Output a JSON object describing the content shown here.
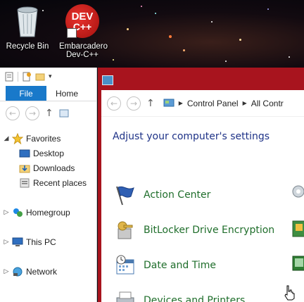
{
  "desktop": {
    "icons": [
      {
        "label": "Recycle Bin"
      },
      {
        "label": "Embarcadero Dev-C++",
        "badge_line1": "DEV",
        "badge_line2": "C++"
      }
    ]
  },
  "explorer": {
    "tabs": {
      "file": "File",
      "home": "Home"
    },
    "nav": [
      {
        "label": "Favorites",
        "icon": "star-icon"
      },
      {
        "label": "Desktop",
        "icon": "desktop-icon"
      },
      {
        "label": "Downloads",
        "icon": "downloads-icon"
      },
      {
        "label": "Recent places",
        "icon": "recent-places-icon"
      },
      {
        "label": "Homegroup",
        "icon": "homegroup-icon"
      },
      {
        "label": "This PC",
        "icon": "this-pc-icon"
      },
      {
        "label": "Network",
        "icon": "network-icon"
      }
    ]
  },
  "control_panel": {
    "breadcrumb": [
      "Control Panel",
      "All Contr"
    ],
    "heading": "Adjust your computer's settings",
    "items": [
      {
        "label": "Action Center",
        "icon": "flag-icon"
      },
      {
        "label": "BitLocker Drive Encryption",
        "icon": "bitlocker-key-icon"
      },
      {
        "label": "Date and Time",
        "icon": "calendar-clock-icon"
      },
      {
        "label": "Devices and Printers",
        "icon": "printer-icon"
      }
    ]
  },
  "colors": {
    "file_tab": "#1979ca",
    "window_frame": "#a8141e",
    "heading": "#1e3287",
    "link": "#1f6e2b"
  }
}
